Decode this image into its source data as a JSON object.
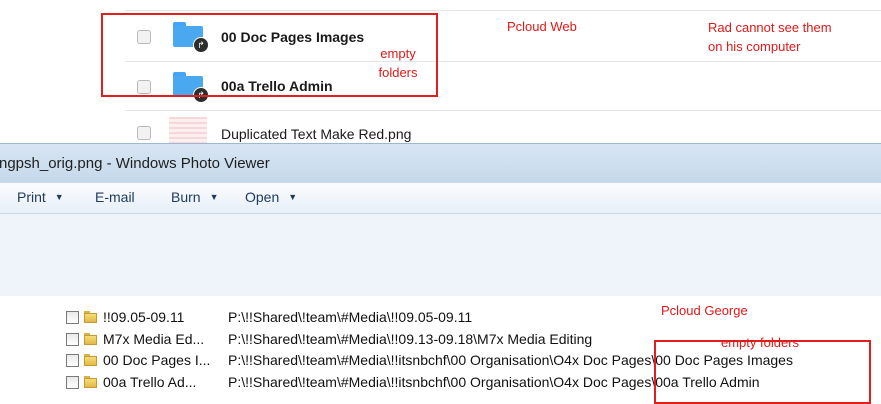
{
  "pcloud_web": {
    "label": "Pcloud Web",
    "note": "Rad cannot see them on his computer",
    "empty_folders_note": "empty folders",
    "items": [
      {
        "name": "00 Doc Pages Images",
        "icon": "shared-folder-icon"
      },
      {
        "name": "00a Trello Admin",
        "icon": "shared-folder-icon"
      },
      {
        "name": "Duplicated Text Make Red.png",
        "icon": "image-thumbnail"
      }
    ],
    "colors": {
      "folder": "#4aa8f0",
      "annotation": "#e11818"
    }
  },
  "photo_viewer": {
    "title": "ngpsh_orig.png - Windows Photo Viewer",
    "menu": [
      {
        "label": "Print",
        "has_dropdown": true
      },
      {
        "label": "E-mail",
        "has_dropdown": false
      },
      {
        "label": "Burn",
        "has_dropdown": true
      },
      {
        "label": "Open",
        "has_dropdown": true
      }
    ]
  },
  "pcloud_george": {
    "label": "Pcloud George",
    "empty_folders_note": "empty folders",
    "rows": [
      {
        "name": "!!09.05-09.11",
        "path": "P:\\!!Shared\\!team\\#Media\\!!09.05-09.11"
      },
      {
        "name": "M7x Media Ed...",
        "path": "P:\\!!Shared\\!team\\#Media\\!!09.13-09.18\\M7x Media Editing"
      },
      {
        "name": "00 Doc Pages I...",
        "path": "P:\\!!Shared\\!team\\#Media\\!!itsnbchf\\00 Organisation\\O4x Doc Pages\\00 Doc Pages Images"
      },
      {
        "name": "00a Trello Ad...",
        "path": "P:\\!!Shared\\!team\\#Media\\!!itsnbchf\\00 Organisation\\O4x Doc Pages\\00a Trello Admin"
      }
    ]
  }
}
